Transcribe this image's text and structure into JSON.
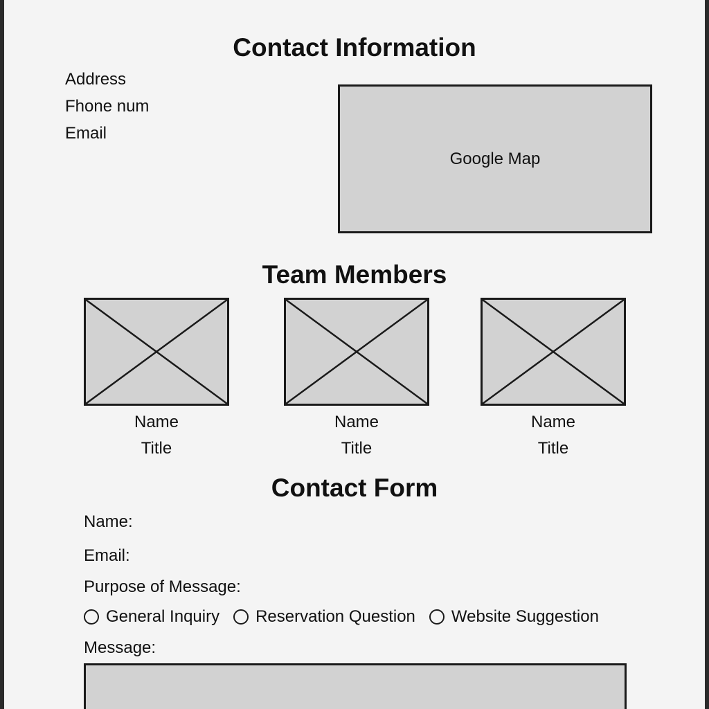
{
  "contact_info": {
    "heading": "Contact Information",
    "lines": [
      "Address",
      "Fhone num",
      "Email"
    ],
    "map_label": "Google Map"
  },
  "team": {
    "heading": "Team Members",
    "members": [
      {
        "name": "Name",
        "title": "Title"
      },
      {
        "name": "Name",
        "title": "Title"
      },
      {
        "name": "Name",
        "title": "Title"
      }
    ]
  },
  "form": {
    "heading": "Contact Form",
    "name_label": "Name:",
    "email_label": "Email:",
    "purpose_label": "Purpose of Message:",
    "options": [
      "General Inquiry",
      "Reservation Question",
      "Website Suggestion"
    ],
    "message_label": "Message:"
  },
  "colors": {
    "background": "#f4f4f4",
    "placeholder_fill": "#d2d2d2",
    "stroke": "#1a1a1a"
  }
}
